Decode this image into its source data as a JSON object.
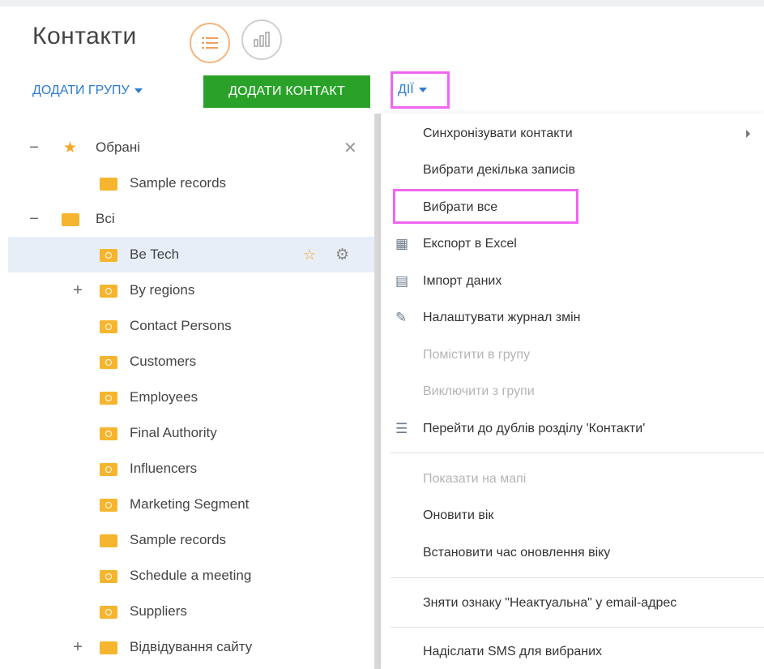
{
  "title": "Контакти",
  "view_icons": {
    "list": "list-icon",
    "chart": "chart-icon"
  },
  "toolbar": {
    "add_group": "ДОДАТИ ГРУПУ",
    "add_contact": "ДОДАТИ КОНТАКТ",
    "actions": "ДІЇ"
  },
  "tree": {
    "favorites": {
      "label": "Обрані",
      "children": [
        "Sample records"
      ]
    },
    "all": {
      "label": "Всі",
      "children": [
        "Be Tech",
        "By regions",
        "Contact Persons",
        "Customers",
        "Employees",
        "Final Authority",
        "Influencers",
        "Marketing Segment",
        "Sample records",
        "Schedule a meeting",
        "Suppliers",
        "Відвідування сайту"
      ]
    }
  },
  "menu": {
    "items": [
      "Синхронізувати контакти",
      "Вибрати декілька записів",
      "Вибрати все",
      "Експорт в Excel",
      "Імпорт даних",
      "Налаштувати журнал змін",
      "Помістити в групу",
      "Виключити з групи",
      "Перейти до дублів розділу 'Контакти'",
      "Показати на мапі",
      "Оновити вік",
      "Встановити час оновлення віку",
      "Зняти ознаку \"Неактуальна\" у email-адрес",
      "Надіслати SMS для вибраних"
    ]
  },
  "colors": {
    "accent_green": "#2aa22a",
    "link_blue": "#2f7bd1",
    "highlight_magenta": "#f066f0",
    "folder_yellow": "#f6b52e",
    "selected_row": "#e7eef7"
  }
}
